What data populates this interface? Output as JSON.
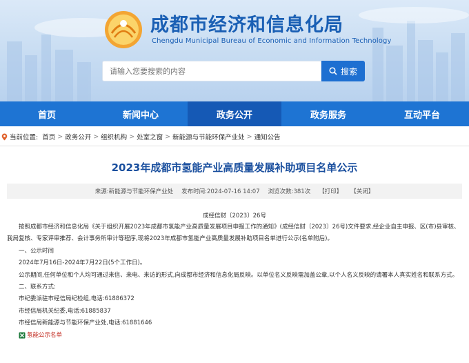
{
  "header": {
    "title": "成都市经济和信息化局",
    "subtitle": "Chengdu Municipal Bureau of Economic and Information Technology"
  },
  "search": {
    "placeholder": "请输入您要搜索的内容",
    "button_label": "搜索"
  },
  "nav": {
    "items": [
      "首页",
      "新闻中心",
      "政务公开",
      "政务服务",
      "互动平台"
    ],
    "active_index": 2
  },
  "breadcrumb": {
    "prefix": "当前位置:",
    "items": [
      "首页",
      "政务公开",
      "组织机构",
      "处室之窗",
      "新能源与节能环保产业处",
      "通知公告"
    ]
  },
  "article": {
    "title": "2023年成都市氢能产业高质量发展补助项目名单公示",
    "meta": {
      "source": "来源:新能源与节能环保产业处",
      "published": "发布时间:2024-07-16 14:07",
      "views": "浏览次数:381次",
      "print_label": "【打印】",
      "close_label": "【关闭】"
    },
    "doc_number": "成经信财〔2023〕26号",
    "paragraphs": [
      "按照成都市经济和信息化局《关于组织开展2023年成都市氢能产业高质量发展项目申报工作的通知》(成经信财〔2023〕26号)文件要求,经企业自主申报、区(市)县审核、我局复核、专家评审推荐、会计事务所审计等程序,现将2023年成都市氢能产业高质量发展补助项目名单进行公示(名单附后)。",
      "一、公示时间",
      "2024年7月16日-2024年7月22日(5个工作日)。",
      "公示期间,任何单位和个人均可通过来信、来电、来访的形式,向成都市经济和信息化局反映。以单位名义反映需加盖公章,以个人名义反映的请署本人真实姓名和联系方式。",
      "二、联系方式:",
      "市纪委派驻市经信局纪检组,电话:61886372",
      "市经信局机关纪委,电话:61885837",
      "市经信局新能源与节能环保产业处,电话:61881646"
    ],
    "attachment": "氢能公示名单"
  },
  "colors": {
    "brand_blue": "#1a5fb4",
    "nav_blue": "#1e74d3",
    "nav_active": "#1559b5",
    "title_blue": "#1a4f9e",
    "attachment_red": "#c0261b"
  }
}
